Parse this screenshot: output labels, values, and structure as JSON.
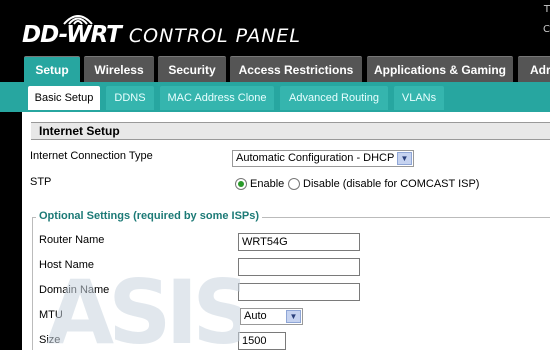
{
  "header": {
    "brand": "DD-WRT",
    "title": "CONTROL PANEL",
    "corner_top": "T",
    "corner_mid": "C"
  },
  "main_tabs": [
    {
      "label": "Setup"
    },
    {
      "label": "Wireless"
    },
    {
      "label": "Security"
    },
    {
      "label": "Access Restrictions"
    },
    {
      "label": "Applications & Gaming"
    },
    {
      "label": "Adr"
    }
  ],
  "sub_tabs": [
    {
      "label": "Basic Setup"
    },
    {
      "label": "DDNS"
    },
    {
      "label": "MAC Address Clone"
    },
    {
      "label": "Advanced Routing"
    },
    {
      "label": "VLANs"
    }
  ],
  "internet_setup": {
    "heading": "Internet Setup",
    "connection_type_label": "Internet Connection Type",
    "connection_type_value": "Automatic Configuration - DHCP",
    "stp_label": "STP",
    "stp_enable": "Enable",
    "stp_disable": "Disable (disable for COMCAST ISP)"
  },
  "optional": {
    "legend": "Optional Settings (required by some ISPs)",
    "router_name_label": "Router Name",
    "router_name_value": "WRT54G",
    "host_name_label": "Host Name",
    "host_name_value": "",
    "domain_name_label": "Domain Name",
    "domain_name_value": "",
    "mtu_label": "MTU",
    "mtu_value": "Auto",
    "size_label": "Size",
    "size_value": "1500"
  },
  "watermark": {
    "text": "ASIS"
  },
  "colors": {
    "accent": "#27a6a0",
    "legend": "#1c7a76"
  }
}
